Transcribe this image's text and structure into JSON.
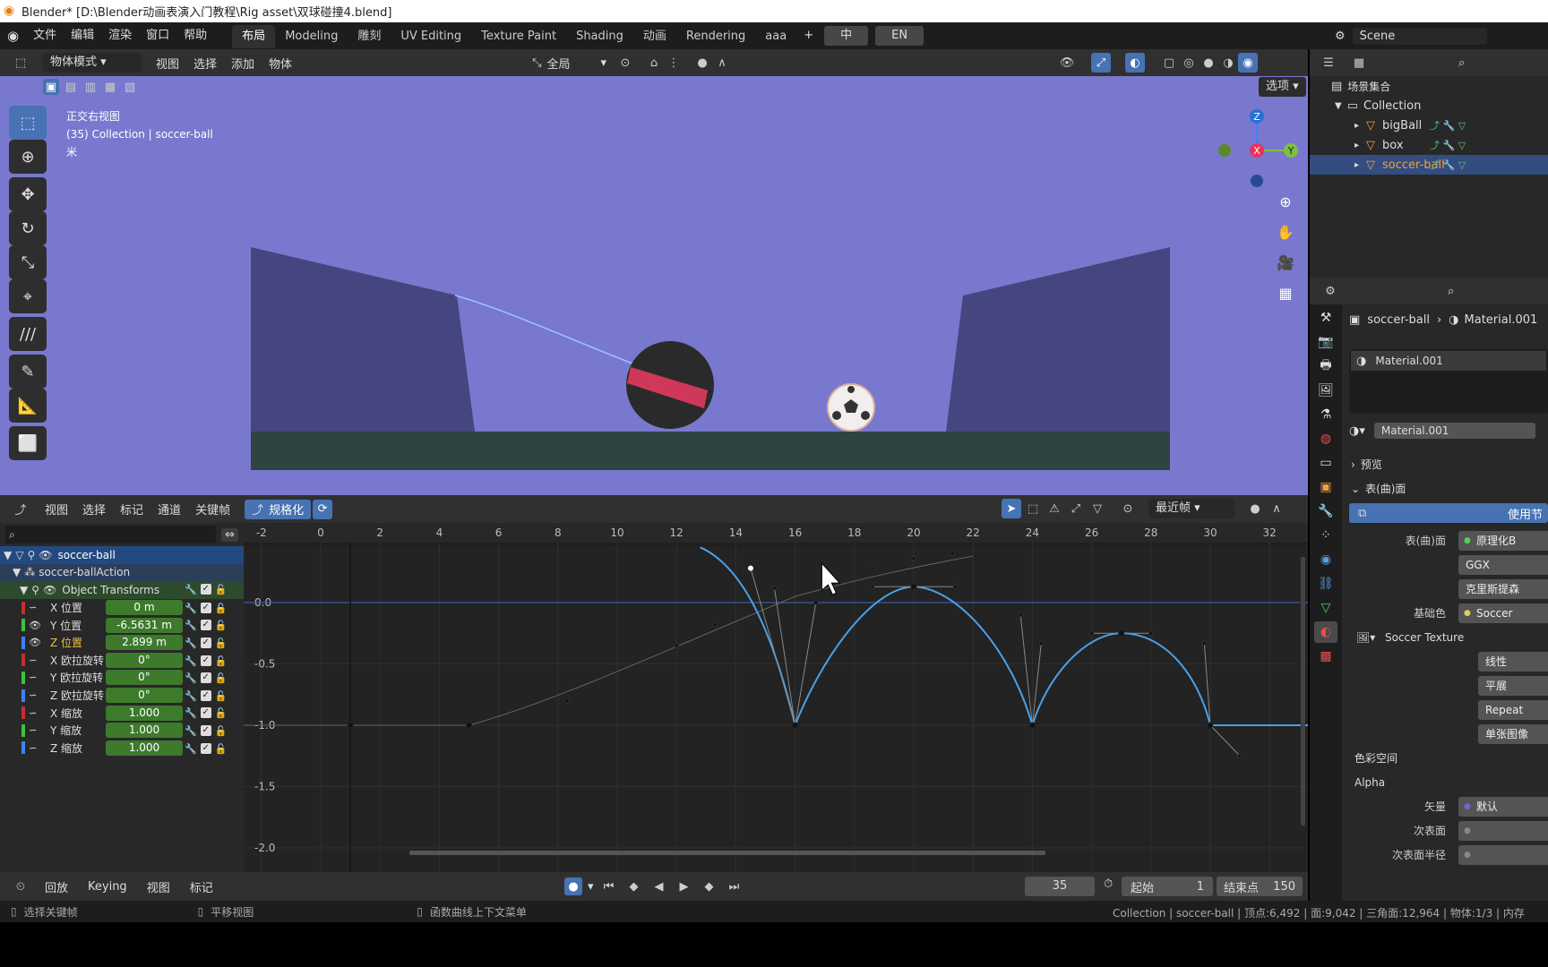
{
  "window": {
    "title": "Blender* [D:\\Blender动画表演入门教程\\Rig asset\\双球碰撞4.blend]"
  },
  "topbar": {
    "menus": [
      "文件",
      "编辑",
      "渲染",
      "窗口",
      "帮助"
    ],
    "workspaces": [
      "布局",
      "Modeling",
      "雕刻",
      "UV Editing",
      "Texture Paint",
      "Shading",
      "动画",
      "Rendering",
      "aaa"
    ],
    "active_workspace": "布局",
    "add_tab": "+",
    "lang_buttons": [
      "中",
      "EN"
    ],
    "scene": "Scene"
  },
  "viewport_header": {
    "mode": "物体模式",
    "menus": [
      "视图",
      "选择",
      "添加",
      "物体"
    ],
    "orientation": "全局",
    "options": "选项"
  },
  "viewport": {
    "view_name": "正交右视图",
    "collection_line": "(35) Collection | soccer-ball",
    "unit": "米",
    "gizmo": {
      "x": "X",
      "y": "Y",
      "z": "Z"
    },
    "colors": {
      "background": "#7878cf",
      "wall": "#454680",
      "floor": "#2f4440",
      "ball_dark": "#2a2a2a",
      "ball_stripe": "#d0385a"
    }
  },
  "graph_editor": {
    "menus": [
      "视图",
      "选择",
      "标记",
      "通道",
      "关键帧"
    ],
    "normalize_label": "规格化",
    "snap_mode": "最近帧",
    "x_ticks": [
      "-2",
      "0",
      "2",
      "4",
      "6",
      "8",
      "10",
      "12",
      "14",
      "16",
      "18",
      "20",
      "22",
      "24",
      "26",
      "28",
      "30",
      "32"
    ],
    "y_ticks": [
      "0.0",
      "-0.5",
      "-1.0",
      "-1.5",
      "-2.0"
    ],
    "curve_color": "#4aa0e8",
    "selected_curve_color": "#3c5aa0"
  },
  "channels": {
    "object": "soccer-ball",
    "action": "soccer-ballAction",
    "group": "Object Transforms",
    "rows": [
      {
        "label": "X 位置",
        "value": "0 m",
        "color": "#c03030"
      },
      {
        "label": "Y 位置",
        "value": "-6.5631 m",
        "color": "#40c040"
      },
      {
        "label": "Z 位置",
        "value": "2.899 m",
        "color": "#4080ff"
      },
      {
        "label": "X 欧拉旋转",
        "value": "0°",
        "color": "#c03030"
      },
      {
        "label": "Y 欧拉旋转",
        "value": "0°",
        "color": "#40c040"
      },
      {
        "label": "Z 欧拉旋转",
        "value": "0°",
        "color": "#4080ff"
      },
      {
        "label": "X 缩放",
        "value": "1.000",
        "color": "#c03030"
      },
      {
        "label": "Y 缩放",
        "value": "1.000",
        "color": "#40c040"
      },
      {
        "label": "Z 缩放",
        "value": "1.000",
        "color": "#4080ff"
      }
    ]
  },
  "timeline": {
    "menus": [
      "回放",
      "Keying",
      "视图",
      "标记"
    ],
    "current_frame": "35",
    "start_label": "起始",
    "start": "1",
    "end_label": "结束点",
    "end": "150"
  },
  "status": {
    "select": "选择关键帧",
    "pan": "平移视图",
    "context": "函数曲线上下文菜单",
    "stats": "Collection | soccer-ball | 顶点:6,492 | 面:9,042 | 三角面:12,964 | 物体:1/3 | 内存"
  },
  "outliner": {
    "root": "场景集合",
    "collection": "Collection",
    "items": [
      "bigBall",
      "box",
      "soccer-ball"
    ],
    "selected": "soccer-ball"
  },
  "properties": {
    "breadcrumb_obj": "soccer-ball",
    "breadcrumb_mat": "Material.001",
    "slot": "Material.001",
    "material": "Material.001",
    "panels": {
      "preview": "预览",
      "surface": "表(曲)面"
    },
    "use_nodes": "使用节",
    "rows": [
      {
        "label": "表(曲)面",
        "value": "原理化B"
      },
      {
        "label": "",
        "value": "GGX"
      },
      {
        "label": "",
        "value": "克里斯提森"
      },
      {
        "label": "基础色",
        "value": "Soccer"
      }
    ],
    "texture": "Soccer Texture",
    "tex_options": [
      "线性",
      "平展",
      "Repeat",
      "单张图像"
    ],
    "color_space": "色彩空间",
    "alpha": "Alpha",
    "bottom_rows": [
      {
        "label": "矢量",
        "value": "默认"
      },
      {
        "label": "次表面",
        "value": ""
      },
      {
        "label": "次表面半径",
        "value": ""
      }
    ]
  }
}
